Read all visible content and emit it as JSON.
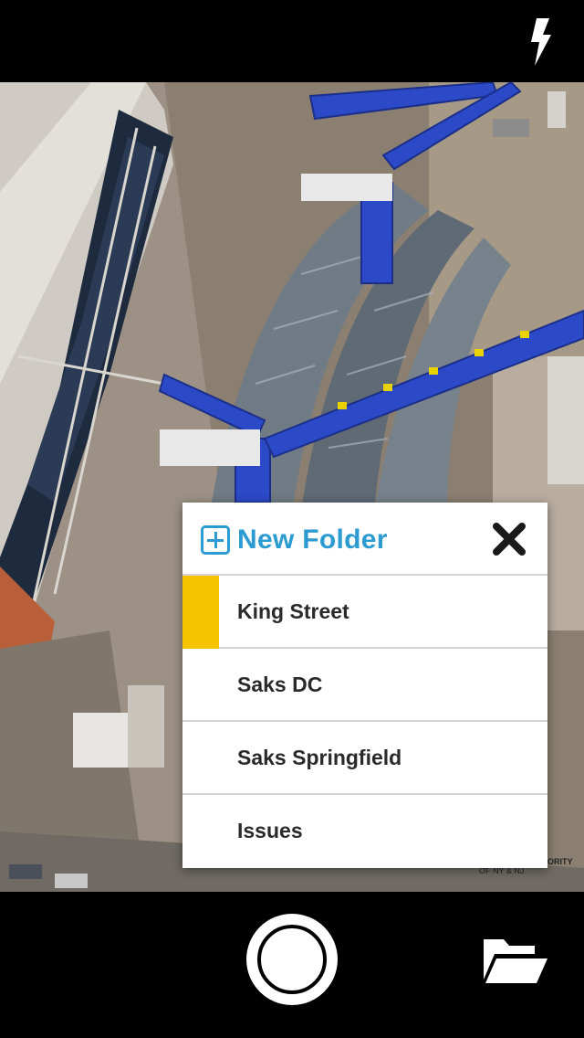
{
  "camera": {
    "flash_icon": "lightning-bolt-icon",
    "shutter_icon": "shutter-circle-icon",
    "folder_icon": "open-folder-icon"
  },
  "photo": {
    "watermark_left": "OF NY & NJ",
    "watermark_right": "ORITY"
  },
  "popup": {
    "new_folder_label": "New Folder",
    "new_folder_icon": "plus-square-icon",
    "close_icon": "close-x-icon",
    "accent_color": "#2b9bd1",
    "selected_color": "#f7c300",
    "folders": [
      {
        "label": "King Street",
        "selected": true
      },
      {
        "label": "Saks DC",
        "selected": false
      },
      {
        "label": "Saks Springfield",
        "selected": false
      },
      {
        "label": "Issues",
        "selected": false
      }
    ]
  }
}
